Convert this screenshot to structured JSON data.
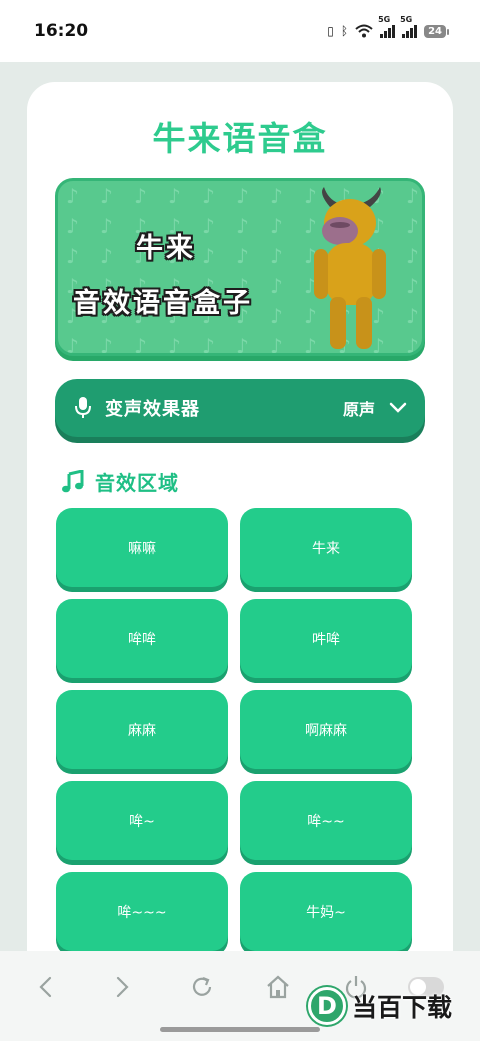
{
  "status_bar": {
    "time": "16:20",
    "signal_label_1": "5G",
    "signal_label_2": "5G",
    "battery": "24"
  },
  "app": {
    "title": "牛来语音盒"
  },
  "banner": {
    "line1": "牛来",
    "line2": "音效语音盒子"
  },
  "voice_changer": {
    "label": "变声效果器",
    "selected": "原声",
    "icon": "microphone-icon"
  },
  "sound_section": {
    "title": "音效区域",
    "icon": "music-note-icon",
    "buttons": [
      "嘛嘛",
      "牛来",
      "哞哞",
      "吽哞",
      "麻麻",
      "啊麻麻",
      "哞~",
      "哞~~",
      "哞~~~",
      "牛妈~"
    ]
  },
  "watermark": {
    "logo_letter": "D",
    "text": "当百下载"
  },
  "colors": {
    "accent": "#23cc8b",
    "title": "#2ecb8e",
    "voice_bar": "#1f9d70"
  }
}
